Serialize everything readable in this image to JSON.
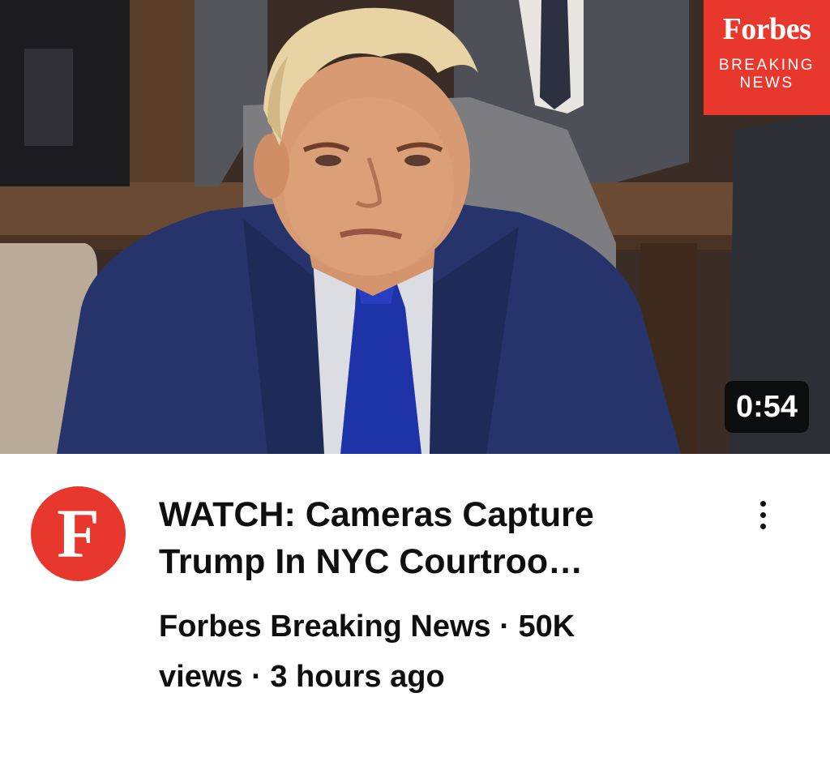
{
  "video": {
    "badge": {
      "brand": "Forbes",
      "line1": "BREAKING",
      "line2": "NEWS"
    },
    "duration": "0:54",
    "channel_avatar_letter": "F",
    "title_line1": "WATCH: Cameras Capture",
    "title_line2": "Trump In NYC Courtroo…",
    "channel_name": "Forbes Breaking News",
    "sep": "·",
    "views_part1": "50K",
    "views_part2": "views",
    "age": "3 hours ago",
    "more_icon": "more-vertical-icon"
  },
  "colors": {
    "brand_red": "#e8382d",
    "text": "#0f0f0f",
    "duration_bg": "#000000",
    "suit_navy": "#26346b",
    "tie_blue": "#1e33a8"
  }
}
